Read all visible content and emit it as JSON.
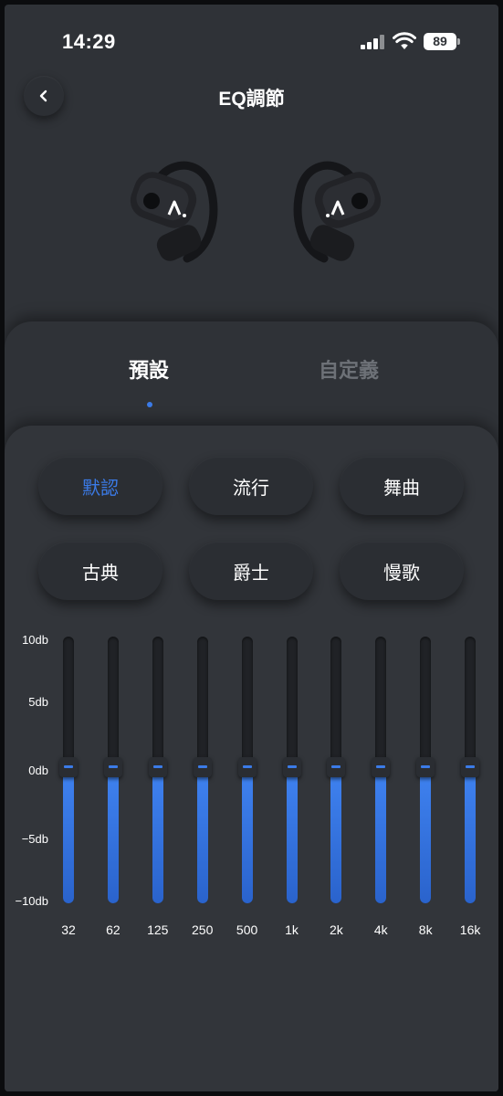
{
  "status_bar": {
    "time": "14:29",
    "battery": "89"
  },
  "header": {
    "title": "EQ調節"
  },
  "tabs": [
    {
      "label": "預設"
    },
    {
      "label": "自定義"
    }
  ],
  "presets": [
    {
      "label": "默認",
      "selected": true
    },
    {
      "label": "流行",
      "selected": false
    },
    {
      "label": "舞曲",
      "selected": false
    },
    {
      "label": "古典",
      "selected": false
    },
    {
      "label": "爵士",
      "selected": false
    },
    {
      "label": "慢歌",
      "selected": false
    }
  ],
  "eq": {
    "db_labels": [
      "10db",
      "5db",
      "0db",
      "−5db",
      "−10db"
    ],
    "bands": [
      {
        "freq": "32",
        "gain_db": 0
      },
      {
        "freq": "62",
        "gain_db": 0
      },
      {
        "freq": "125",
        "gain_db": 0
      },
      {
        "freq": "250",
        "gain_db": 0
      },
      {
        "freq": "500",
        "gain_db": 0
      },
      {
        "freq": "1k",
        "gain_db": 0
      },
      {
        "freq": "2k",
        "gain_db": 0
      },
      {
        "freq": "4k",
        "gain_db": 0
      },
      {
        "freq": "8k",
        "gain_db": 0
      },
      {
        "freq": "16k",
        "gain_db": 0
      }
    ],
    "range_db": [
      -10,
      10
    ]
  },
  "colors": {
    "accent": "#3b7be8",
    "background": "#2f3237",
    "inactive_tab": "#6d7177"
  }
}
